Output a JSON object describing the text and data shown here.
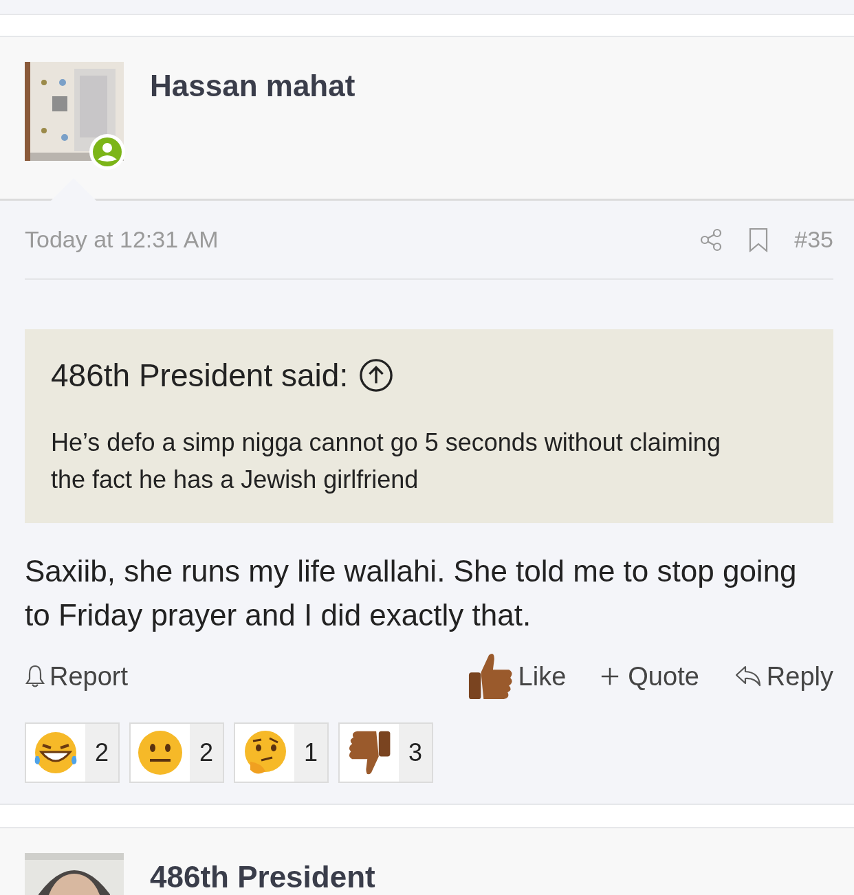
{
  "post": {
    "author": "Hassan mahat",
    "online": true,
    "time": "Today at 12:31 AM",
    "number": "#35",
    "quote": {
      "attribution": "486th President said:",
      "text": "He’s defo a simp nigga cannot go 5 seconds without claiming the fact he has a Jewish girlfriend"
    },
    "body": "Saxiib, she runs my life wallahi. She told me to stop going to Friday prayer and I did exactly that.",
    "actions_left": [
      "Report"
    ],
    "actions_right": [
      {
        "kind": "like",
        "label": "Like"
      },
      {
        "kind": "quote",
        "label": "Quote"
      },
      {
        "kind": "reply",
        "label": "Reply"
      }
    ],
    "reactions": [
      {
        "kind": "laugh",
        "count": "2"
      },
      {
        "kind": "neutral",
        "count": "2"
      },
      {
        "kind": "thinking",
        "count": "1"
      },
      {
        "kind": "dislike",
        "count": "3"
      }
    ]
  },
  "next_post": {
    "author": "486th President"
  }
}
